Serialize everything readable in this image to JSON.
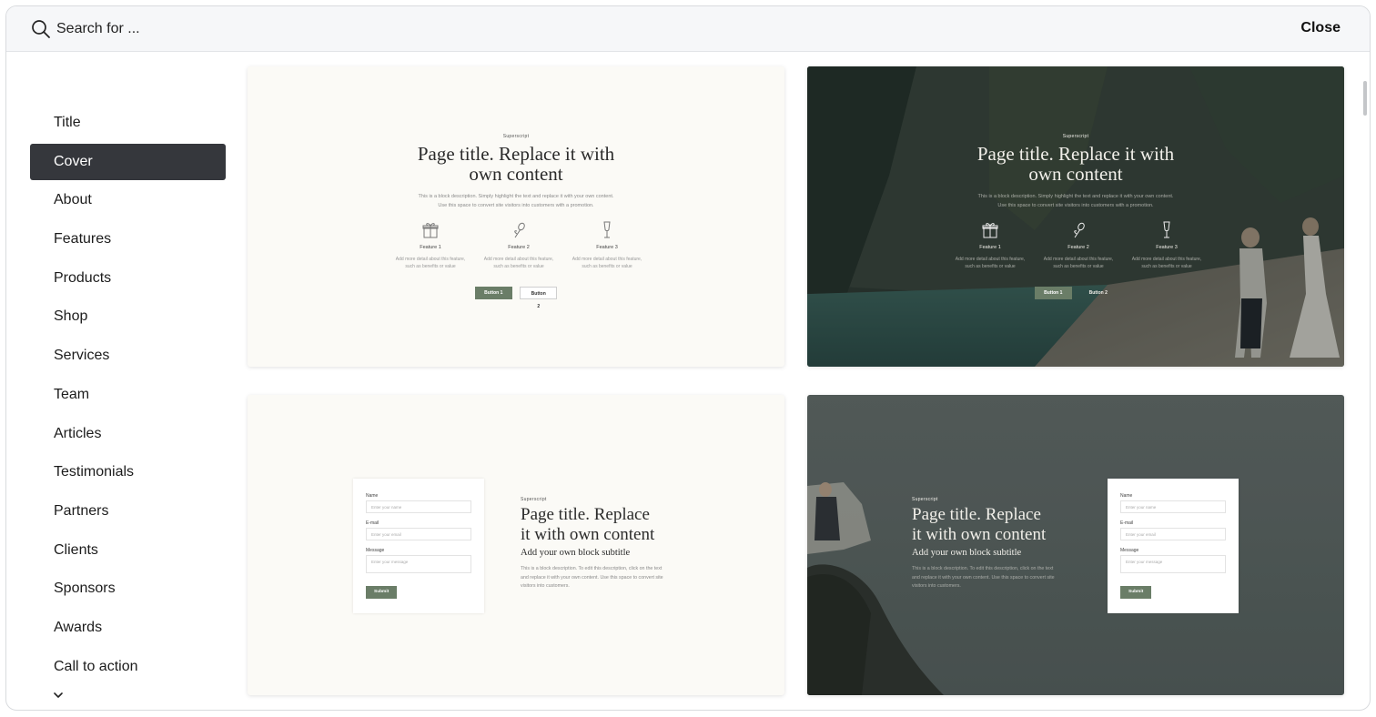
{
  "search": {
    "placeholder": "Search for ..."
  },
  "header": {
    "close_label": "Close"
  },
  "sidebar": {
    "items": [
      {
        "label": "Title"
      },
      {
        "label": "Cover"
      },
      {
        "label": "About"
      },
      {
        "label": "Features"
      },
      {
        "label": "Products"
      },
      {
        "label": "Shop"
      },
      {
        "label": "Services"
      },
      {
        "label": "Team"
      },
      {
        "label": "Articles"
      },
      {
        "label": "Testimonials"
      },
      {
        "label": "Partners"
      },
      {
        "label": "Clients"
      },
      {
        "label": "Sponsors"
      },
      {
        "label": "Awards"
      },
      {
        "label": "Call to action"
      }
    ],
    "active": "Cover",
    "more_icon": "chevron-down-icon"
  },
  "templates": {
    "cover_features": {
      "superscript": "Superscript",
      "title_line1": "Page title. Replace it with",
      "title_line2": "own content",
      "desc_line1": "This is a block description. Simply highlight the text and replace it with your own content.",
      "desc_line2": "Use this space to convert site visitors into customers with a promotion.",
      "features": [
        {
          "name": "Feature 1",
          "icon": "gift-icon",
          "desc1": "Add more detail about this feature,",
          "desc2": "such as benefits or value"
        },
        {
          "name": "Feature 2",
          "icon": "flower-icon",
          "desc1": "Add more detail about this feature,",
          "desc2": "such as benefits or value"
        },
        {
          "name": "Feature 3",
          "icon": "glass-icon",
          "desc1": "Add more detail about this feature,",
          "desc2": "such as benefits or value"
        }
      ],
      "button1": "Button 1",
      "button2": "Button 2"
    },
    "cover_form": {
      "superscript": "Superscript",
      "title_line1": "Page title. Replace",
      "title_line2": "it with own content",
      "subtitle": "Add your own block subtitle",
      "desc_line1": "This is a block description. To edit this description, click on the text",
      "desc_line2": "and replace it with your own content. Use this space to convert site",
      "desc_line3": "visitors into customers.",
      "form": {
        "name_label": "Name",
        "name_placeholder": "Enter your name",
        "email_label": "E-mail",
        "email_placeholder": "Enter your email",
        "message_label": "Message",
        "message_placeholder": "Enter your message",
        "submit_label": "Submit"
      }
    }
  },
  "colors": {
    "accent_green": "#6a7d67",
    "active_item_bg": "#35373c",
    "card_light_bg": "#fbfaf6",
    "topbar_bg": "#f6f7f9"
  }
}
